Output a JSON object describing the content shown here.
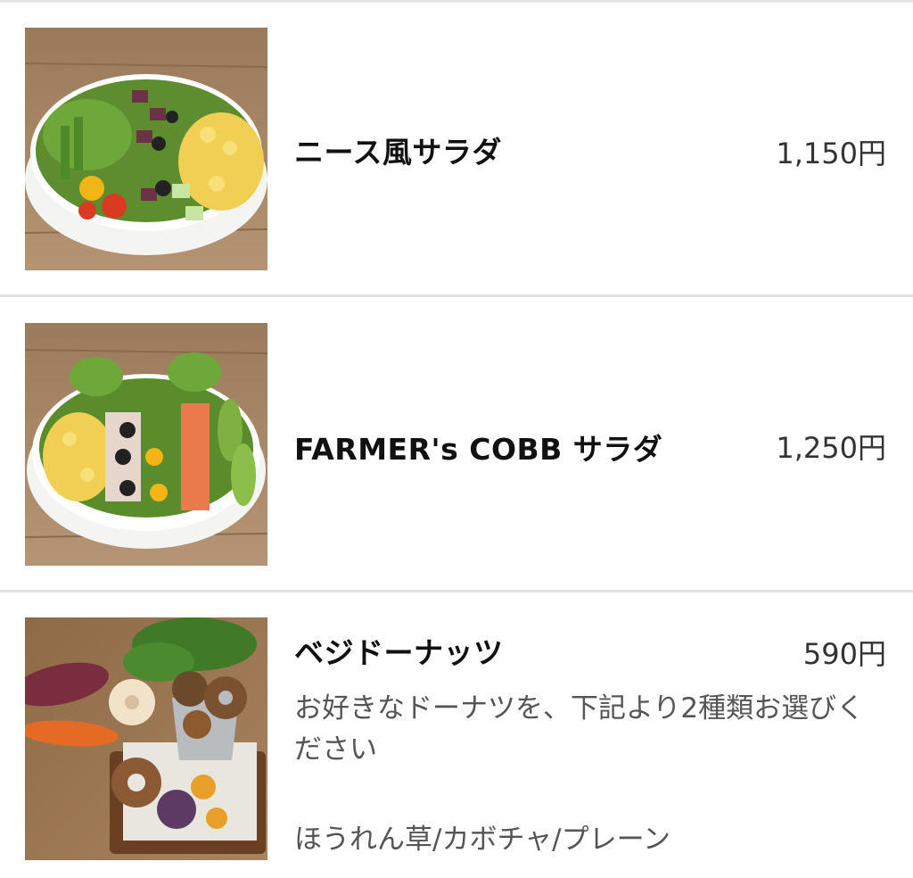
{
  "menu": {
    "items": [
      {
        "name": "ニース風サラダ",
        "price": "1,150円",
        "image": "nicoise-salad-photo"
      },
      {
        "name": "FARMER's COBB サラダ",
        "price": "1,250円",
        "image": "cobb-salad-photo"
      },
      {
        "name": "ベジドーナッツ",
        "price": "590円",
        "description": "お好きなドーナツを、下記より2種類お選びください",
        "options": "ほうれん草/カボチャ/プレーン",
        "image": "veggie-donuts-photo"
      }
    ]
  },
  "colors": {
    "divider": "#e3e3e3",
    "name_text": "#111111",
    "price_text": "#333333",
    "desc_text": "#555555"
  }
}
